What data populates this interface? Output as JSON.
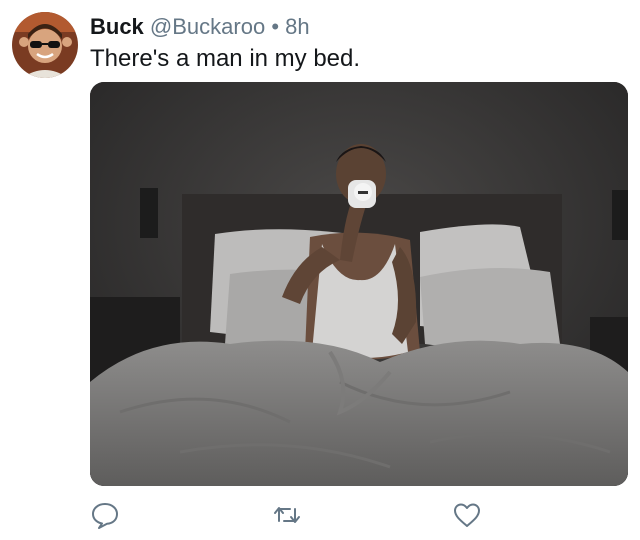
{
  "tweet": {
    "author": {
      "name": "Buck",
      "handle": "@Buckaroo",
      "separator": "•",
      "time": "8h"
    },
    "text": "There's a man in my bed.",
    "media": {
      "kind": "photo"
    },
    "actions": {
      "reply_icon": "speech-bubble-icon",
      "retweet_icon": "retweet-icon",
      "like_icon": "heart-icon"
    },
    "colors": {
      "name": "#14171a",
      "meta": "#657786",
      "icon": "#657786"
    }
  }
}
